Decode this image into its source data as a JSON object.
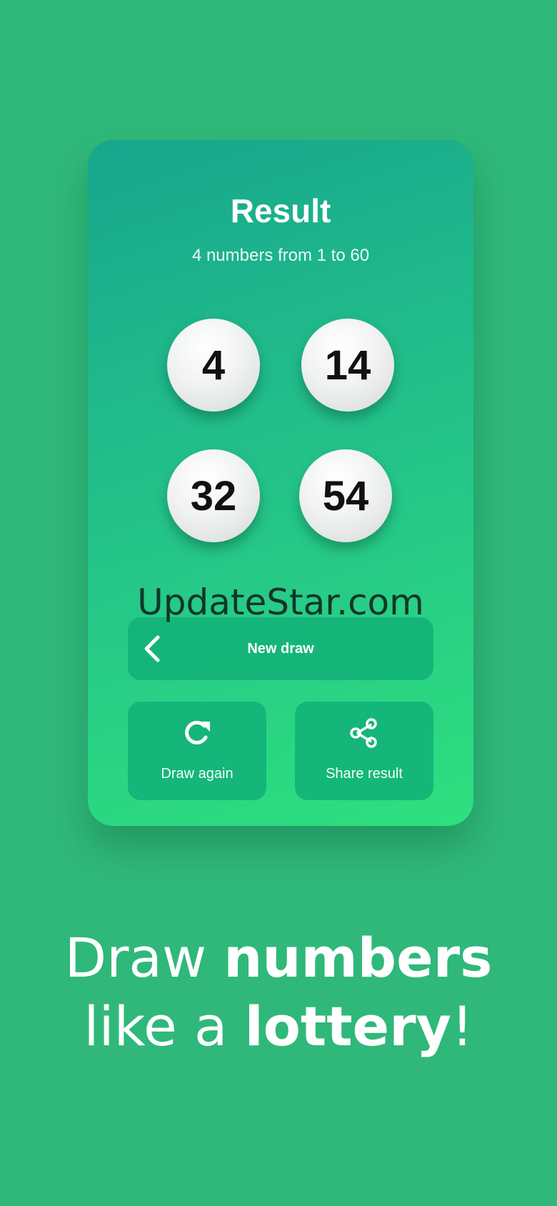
{
  "card": {
    "title": "Result",
    "subtitle": "4 numbers from 1 to 60",
    "numbers": [
      "4",
      "14",
      "32",
      "54"
    ]
  },
  "watermark": "UpdateStar.com",
  "buttons": {
    "new_draw": "New draw",
    "draw_again": "Draw again",
    "share_result": "Share result"
  },
  "icons": {
    "back": "chevron-left-icon",
    "redo": "redo-icon",
    "share": "share-icon"
  },
  "tagline": {
    "line1_part1": "Draw ",
    "line1_part2": "numbers",
    "line2_part1": "like a ",
    "line2_part2": "lottery",
    "line2_part3": "!"
  },
  "colors": {
    "background": "#2fb87a",
    "card_top": "#17a68d",
    "card_bottom": "#2ee07e",
    "button": "#12b078"
  }
}
